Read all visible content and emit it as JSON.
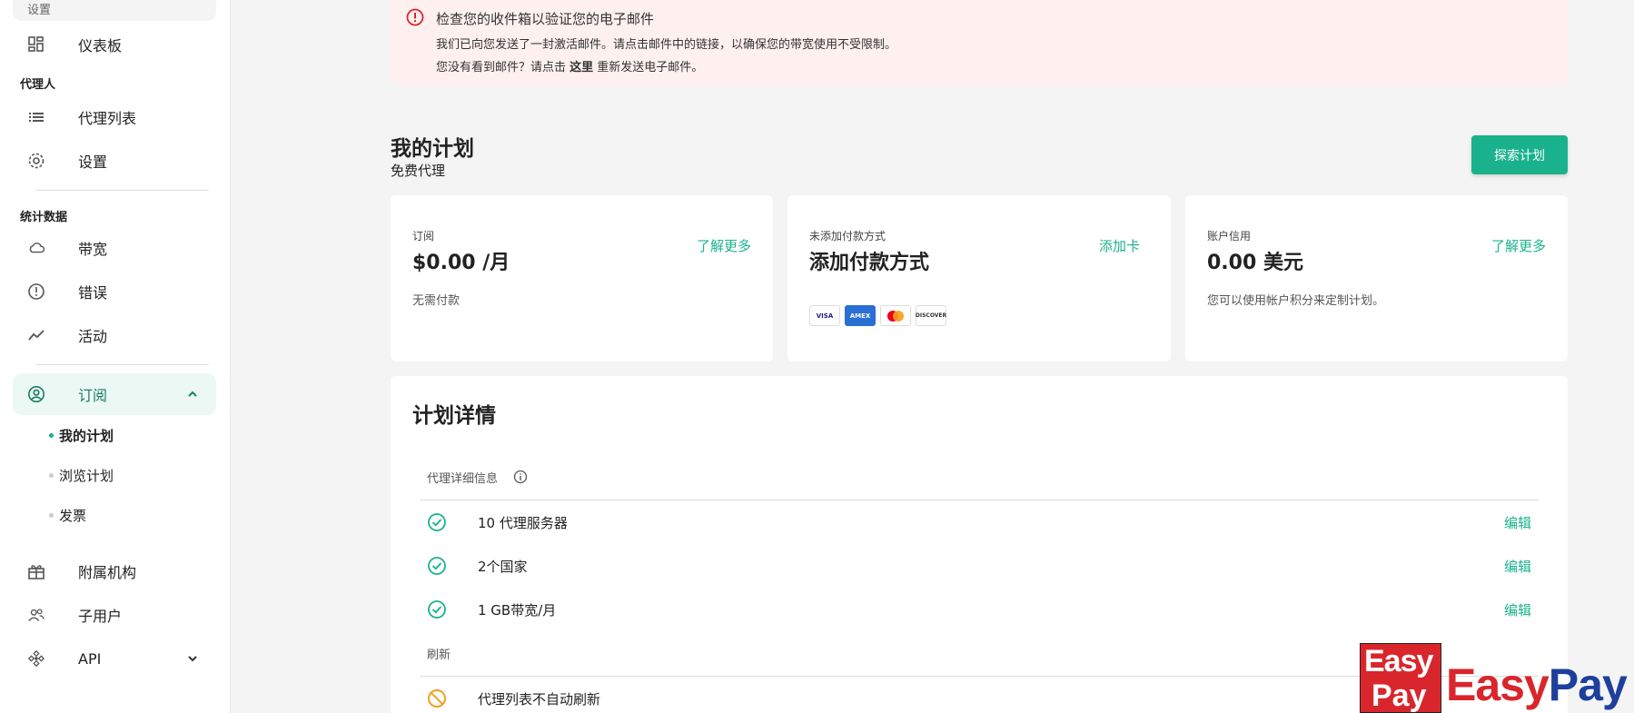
{
  "sidebar": {
    "top_stub": "设置",
    "dashboard": "仪表板",
    "section_proxy": "代理人",
    "proxy_list": "代理列表",
    "settings": "设置",
    "section_stats": "统计数据",
    "bandwidth": "带宽",
    "errors": "错误",
    "activity": "活动",
    "subscription": "订阅",
    "sub_items": [
      "我的计划",
      "浏览计划",
      "发票"
    ],
    "affiliate": "附属机构",
    "sub_users": "子用户",
    "api": "API"
  },
  "alert": {
    "title": "检查您的收件箱以验证您的电子邮件",
    "line1": "我们已向您发送了一封激活邮件。请点击邮件中的链接，以确保您的带宽使用不受限制。",
    "line2_pre": "您没有看到邮件？请点击 ",
    "line2_link": "这里",
    "line2_post": " 重新发送电子邮件。"
  },
  "plan": {
    "title": "我的计划",
    "subtitle": "免费代理",
    "explore_button": "探索计划"
  },
  "cards": {
    "subscription": {
      "label": "订阅",
      "value": "$0.00 /月",
      "link": "了解更多",
      "desc": "无需付款"
    },
    "payment": {
      "label": "未添加付款方式",
      "value": "添加付款方式",
      "link": "添加卡",
      "brands": [
        "VISA",
        "AMEX",
        "mastercard",
        "DISCOVER"
      ]
    },
    "credit": {
      "label": "账户信用",
      "value": "0.00 美元",
      "link": "了解更多",
      "desc": "您可以使用帐户积分来定制计划。"
    }
  },
  "details": {
    "title": "计划详情",
    "group_proxy": "代理详细信息",
    "rows": [
      {
        "text": "10 代理服务器",
        "edit": "编辑"
      },
      {
        "text": "2个国家",
        "edit": "编辑"
      },
      {
        "text": "1 GB带宽/月",
        "edit": "编辑"
      }
    ],
    "group_refresh": "刷新",
    "refresh_row": "代理列表不自动刷新"
  },
  "watermark": {
    "box_top": "Easy",
    "box_bottom": "Pay",
    "text_easy": "Easy",
    "text_pay": "Pay"
  },
  "colors": {
    "accent": "#1ab28d",
    "alert_bg": "#fdf0ef",
    "alert_icon": "#d9262c",
    "warn": "#f0a020"
  }
}
